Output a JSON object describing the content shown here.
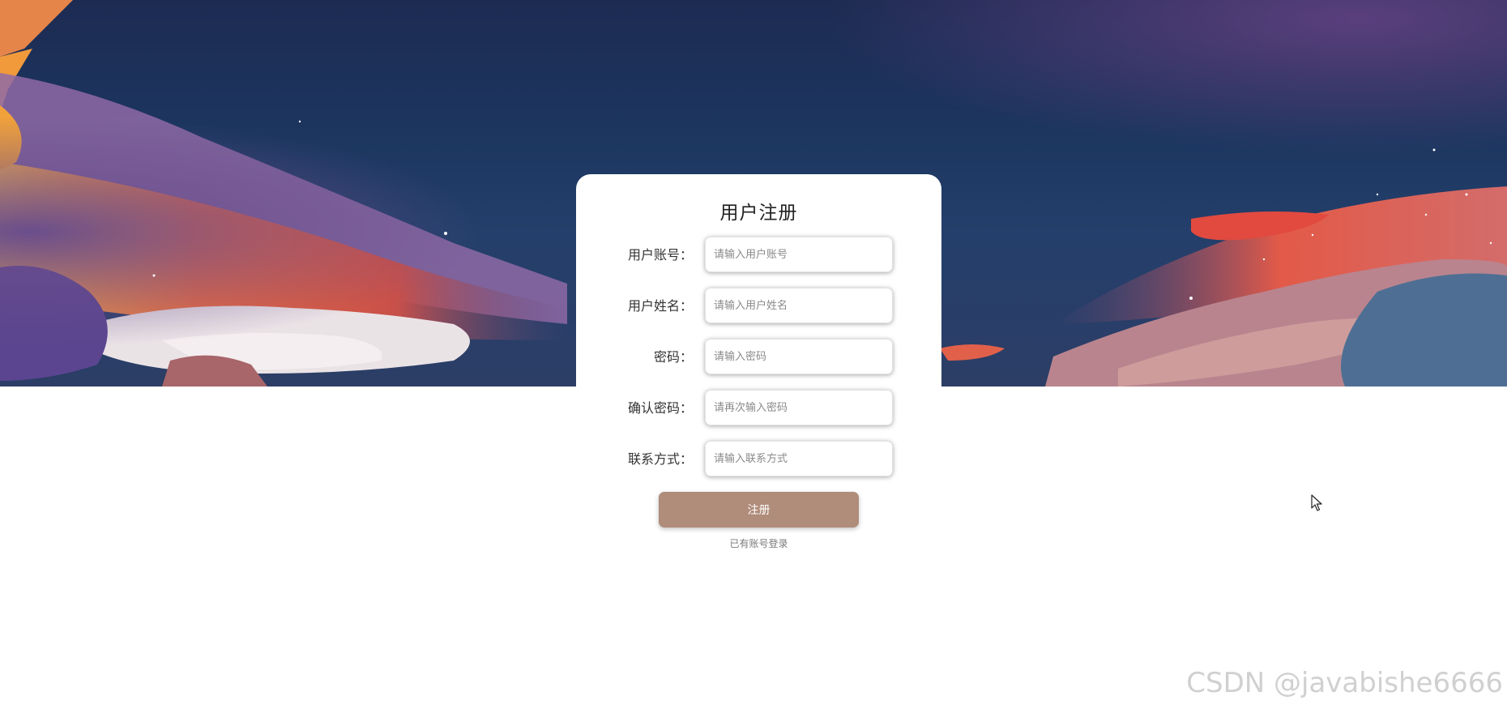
{
  "form": {
    "title": "用户注册",
    "fields": [
      {
        "label": "用户账号：",
        "placeholder": "请输入用户账号",
        "value": ""
      },
      {
        "label": "用户姓名：",
        "placeholder": "请输入用户姓名",
        "value": ""
      },
      {
        "label": "密码：",
        "placeholder": "请输入密码",
        "value": ""
      },
      {
        "label": "确认密码：",
        "placeholder": "请再次输入密码",
        "value": ""
      },
      {
        "label": "联系方式：",
        "placeholder": "请输入联系方式",
        "value": ""
      }
    ],
    "submit_label": "注册",
    "login_link": "已有账号登录"
  },
  "watermark": "CSDN @javabishe6666",
  "colors": {
    "button": "#b08c7a",
    "card": "#ffffff",
    "sky_top": "#1d2b52",
    "sunset_orange": "#f07a3a"
  }
}
